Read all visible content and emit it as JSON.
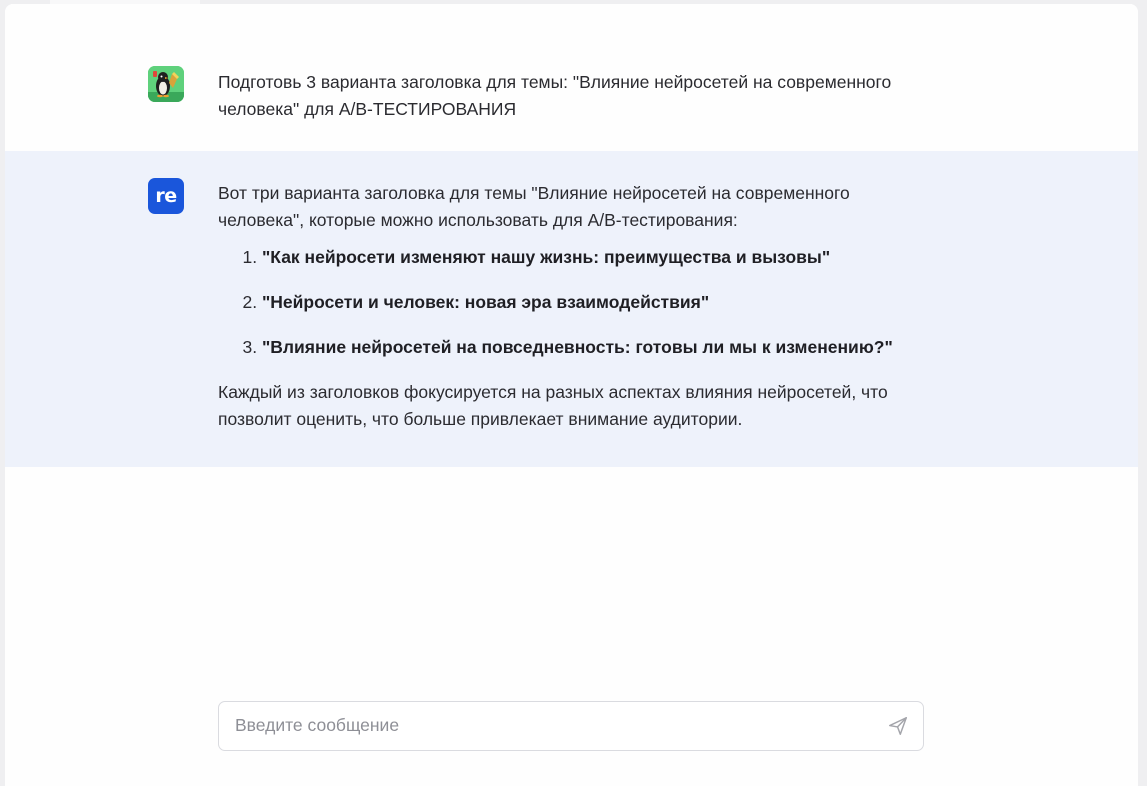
{
  "conversation": {
    "user_message": {
      "avatar": "user-avatar-image",
      "text": "Подготовь 3 варианта заголовка для темы: \"Влияние нейросетей на современного человека\" для А/В-ТЕСТИРОВАНИЯ"
    },
    "assistant_message": {
      "avatar_label": "re",
      "intro": "Вот три варианта заголовка для темы \"Влияние нейросетей на современного человека\", которые можно использовать для А/В-тестирования:",
      "options": [
        "\"Как нейросети изменяют нашу жизнь: преимущества и вызовы\"",
        "\"Нейросети и человек: новая эра взаимодействия\"",
        "\"Влияние нейросетей на повседневность: готовы ли мы к изменению?\""
      ],
      "outro": "Каждый из заголовков фокусируется на разных аспектах влияния нейросетей, что позволит оценить, что больше привлекает внимание аудитории."
    }
  },
  "composer": {
    "placeholder": "Введите сообщение",
    "value": "",
    "send_icon": "send-icon"
  },
  "colors": {
    "accent": "#1a56db",
    "assistant_bg": "#eef2fb",
    "user_avatar_bg": "#5fd17c"
  }
}
